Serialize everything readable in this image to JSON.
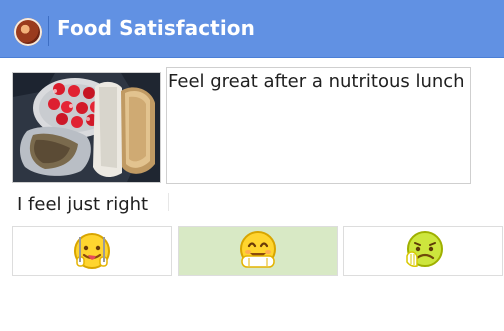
{
  "header": {
    "title": "Food Satisfaction",
    "icon": "app-food-icon",
    "background": "#6191e3"
  },
  "meal": {
    "photo": "lunch-photo",
    "comment": "Feel great after a nutritous lunch"
  },
  "feeling": {
    "label": "I feel just right",
    "options": [
      {
        "name": "eating-happy-icon",
        "selected": false
      },
      {
        "name": "satisfied-icon",
        "selected": true
      },
      {
        "name": "sick-icon",
        "selected": false
      }
    ],
    "selected_color": "#d8e9c5"
  }
}
